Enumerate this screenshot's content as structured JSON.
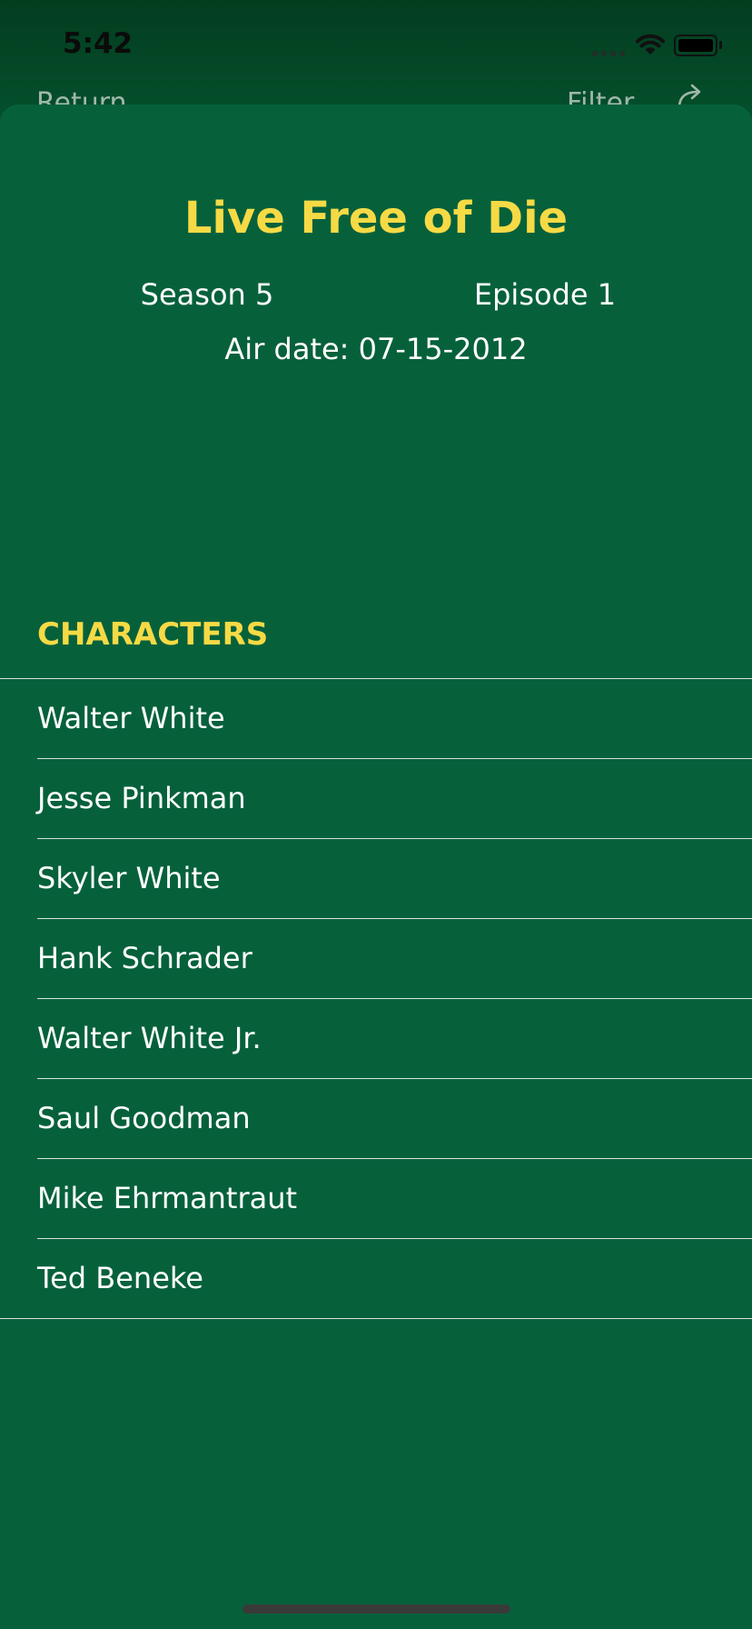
{
  "status_bar": {
    "time": "5:42"
  },
  "nav": {
    "back_label": "Return",
    "filter_label": "Filter",
    "share_icon": "share-icon"
  },
  "episode": {
    "title": "Live Free of Die",
    "season": "Season 5",
    "episode": "Episode 1",
    "air_date": "Air date: 07-15-2012"
  },
  "characters": {
    "header": "CHARACTERS",
    "items": [
      "Walter White",
      "Jesse Pinkman",
      "Skyler White",
      "Hank Schrader",
      "Walter White Jr.",
      "Saul Goodman",
      "Mike Ehrmantraut",
      "Ted Beneke"
    ]
  },
  "colors": {
    "accent": "#f6da45",
    "background": "#06613b",
    "text": "#ffffff"
  }
}
